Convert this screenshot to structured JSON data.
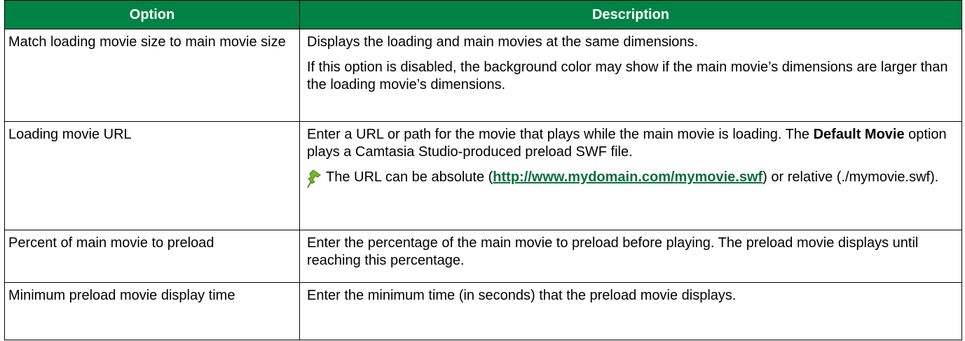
{
  "table": {
    "headers": {
      "option": "Option",
      "description": "Description"
    },
    "rows": [
      {
        "option": "Match loading movie size to main movie size",
        "desc_1": "Displays the loading and main movies at the same dimensions.",
        "desc_2": "If this option is disabled, the background color may show if the main movie’s dimensions are larger than the loading movie’s dimensions."
      },
      {
        "option": "Loading movie URL",
        "desc_1a": "Enter a URL or path for the movie that plays while the main movie is loading. The ",
        "desc_1_bold": "Default Movie",
        "desc_1b": " option plays a Camtasia Studio-produced preload SWF file.",
        "note_a": "The URL can be absolute (",
        "note_link": "http://www.mydomain.com/mymovie.swf",
        "note_b": ") or relative (./mymovie.swf).",
        "note_icon": "pushpin-icon"
      },
      {
        "option": "Percent of main movie to preload",
        "desc_1": "Enter the percentage of the main movie to preload before playing. The preload movie displays until reaching this percentage."
      },
      {
        "option": "Minimum preload movie display time",
        "desc_1": "Enter the minimum time (in seconds) that the preload movie displays."
      }
    ]
  },
  "colors": {
    "header_bg": "#008345",
    "header_text": "#ffffff",
    "link": "#0b6e3b"
  }
}
